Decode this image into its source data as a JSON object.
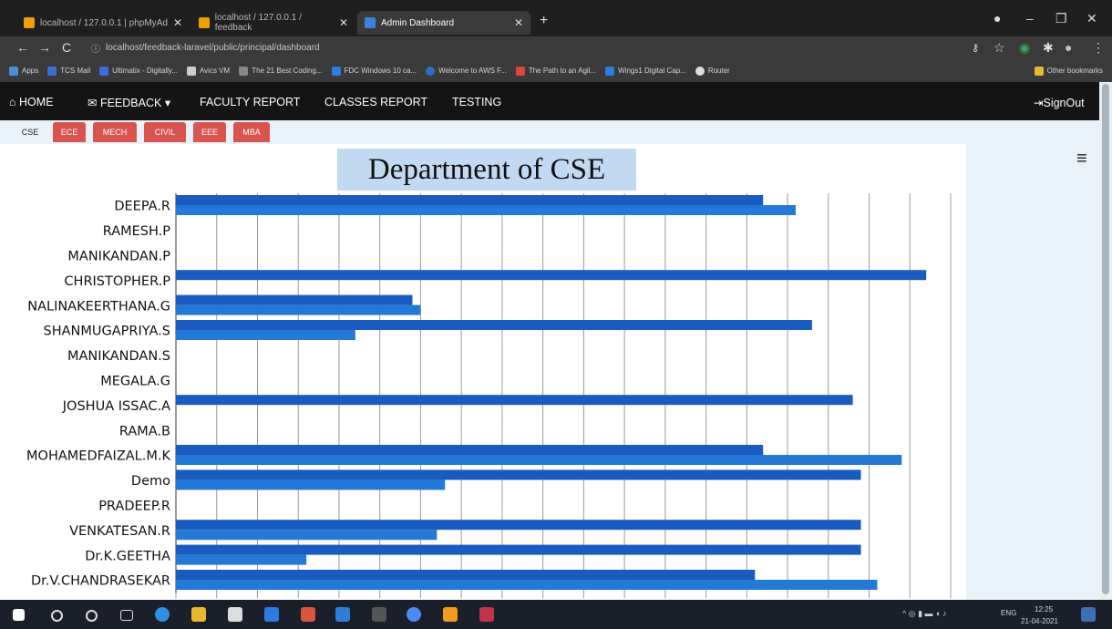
{
  "browser": {
    "tabs": [
      {
        "title": "localhost / 127.0.0.1 | phpMyAd",
        "favicon_color": "#f0a000"
      },
      {
        "title": "localhost / 127.0.0.1 / feedback",
        "favicon_color": "#f0a000"
      },
      {
        "title": "Admin Dashboard",
        "favicon_color": "#3b82d6"
      }
    ],
    "url": "localhost/feedback-laravel/public/principal/dashboard",
    "bookmarks": [
      {
        "label": "Apps",
        "color": "#4a90d9"
      },
      {
        "label": "TCS Mail",
        "color": "#3b6fd6"
      },
      {
        "label": "Ultimatix - Digitally...",
        "color": "#3b6fd6"
      },
      {
        "label": "Avics VM",
        "color": "#cccccc"
      },
      {
        "label": "The 21 Best Coding...",
        "color": "#888888"
      },
      {
        "label": "FDC Windows 10 ca...",
        "color": "#2a7de1"
      },
      {
        "label": "Welcome to AWS F...",
        "color": "#2a6ec9"
      },
      {
        "label": "The Path to an Agil...",
        "color": "#d9473a"
      },
      {
        "label": "Wings1 Digital Cap...",
        "color": "#2a7de1"
      },
      {
        "label": "Router",
        "color": "#dddddd"
      }
    ],
    "other_bookmarks": "Other bookmarks"
  },
  "nav": {
    "home": "HOME",
    "feedback": "FEEDBACK",
    "faculty_report": "FACULTY REPORT",
    "classes_report": "CLASSES REPORT",
    "testing": "TESTING",
    "signout": "SignOut"
  },
  "departments": [
    "CSE",
    "ECE",
    "MECH",
    "CIVIL",
    "EEE",
    "MBA"
  ],
  "selected_department": "CSE",
  "chart_data": {
    "type": "bar",
    "orientation": "horizontal",
    "title": "Department of CSE",
    "categories": [
      "DEEPA.R",
      "RAMESH.P",
      "MANIKANDAN.P",
      "CHRISTOPHER.P",
      "NALINAKEERTHANA.G",
      "SHANMUGAPRIYA.S",
      "MANIKANDAN.S",
      "MEGALA.G",
      "JOSHUA ISSAC.A",
      "RAMA.B",
      "MOHAMEDFAIZAL.M.K",
      "Demo",
      "PRADEEP.R",
      "VENKATESAN.R",
      "Dr.K.GEETHA",
      "Dr.V.CHANDRASEKAR"
    ],
    "series": [
      {
        "color": "#1a5bbf",
        "values": [
          72,
          0,
          0,
          92,
          29,
          78,
          0,
          0,
          83,
          0,
          72,
          84,
          0,
          84,
          84,
          71
        ]
      },
      {
        "color": "#2479d6",
        "values": [
          76,
          0,
          0,
          0,
          30,
          22,
          0,
          0,
          0,
          0,
          89,
          33,
          0,
          32,
          16,
          86
        ]
      }
    ],
    "xlim": [
      0,
      95
    ],
    "xticks": [
      0,
      5,
      10,
      15,
      20,
      25,
      30,
      35,
      40,
      45,
      50,
      55,
      60,
      65,
      70,
      75,
      80,
      85,
      90,
      95
    ],
    "grid": true
  },
  "taskbar": {
    "lang": "ENG",
    "time": "12:25",
    "date": "21-04-2021"
  }
}
